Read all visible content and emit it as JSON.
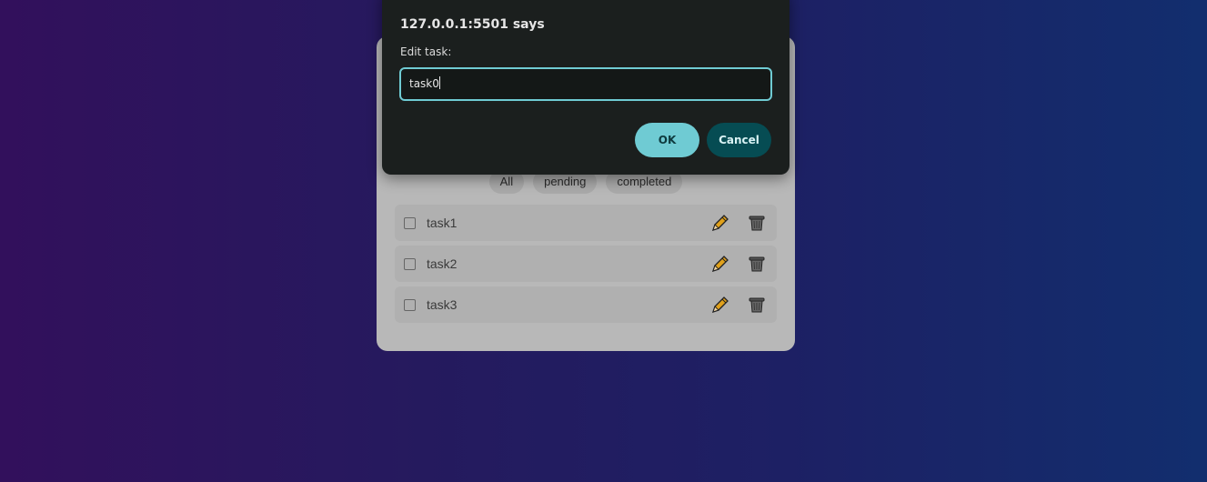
{
  "dialog": {
    "title": "127.0.0.1:5501 says",
    "message": "Edit task:",
    "input_value": "task0",
    "ok_label": "OK",
    "cancel_label": "Cancel"
  },
  "filters": [
    {
      "label": "All"
    },
    {
      "label": "pending"
    },
    {
      "label": "completed"
    }
  ],
  "tasks": [
    {
      "text": "task1",
      "completed": false
    },
    {
      "text": "task2",
      "completed": false
    },
    {
      "text": "task3",
      "completed": false
    }
  ],
  "icons": {
    "edit": "pencil-icon",
    "delete": "trash-icon"
  },
  "colors": {
    "accent": "#6fcbd3",
    "cancel_bg": "#064c53",
    "dialog_bg": "#1b1f1e"
  }
}
